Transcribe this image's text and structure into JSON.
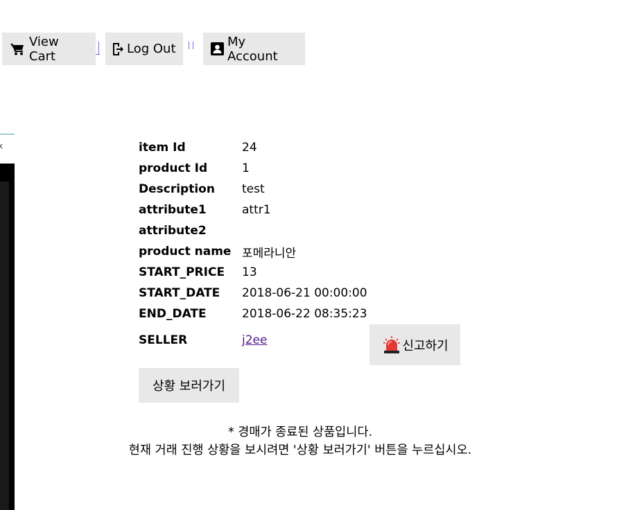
{
  "toolbar": {
    "view_cart_label": "View Cart",
    "log_out_label": "Log Out",
    "my_account_label": "My Account"
  },
  "item": {
    "rows": [
      {
        "key": "item Id",
        "value": "24"
      },
      {
        "key": "product Id",
        "value": "1"
      },
      {
        "key": "Description",
        "value": "test"
      },
      {
        "key": "attribute1",
        "value": "attr1"
      },
      {
        "key": "attribute2",
        "value": ""
      },
      {
        "key": "product name",
        "value": "포메라니안"
      },
      {
        "key": "START_PRICE",
        "value": "13"
      },
      {
        "key": "START_DATE",
        "value": "2018-06-21 00:00:00"
      },
      {
        "key": "END_DATE",
        "value": "2018-06-22 08:35:23"
      }
    ],
    "seller_label": "SELLER",
    "seller_value": "j2ee"
  },
  "actions": {
    "report_label": "신고하기",
    "status_label": "상황 보러가기"
  },
  "notice": {
    "line1": "* 경매가 종료된 상품입니다.",
    "line2": "현재 거래 진행 상황을 보시려면 '상황 보러가기' 버튼을 누르십시오."
  },
  "colors": {
    "button_bg": "#e8e8e8",
    "link_visited": "#551a8b",
    "separator": "#6a6aff",
    "siren_red": "#e53935"
  },
  "icons": [
    "cart-icon",
    "logout-icon",
    "account-icon",
    "siren-icon"
  ]
}
